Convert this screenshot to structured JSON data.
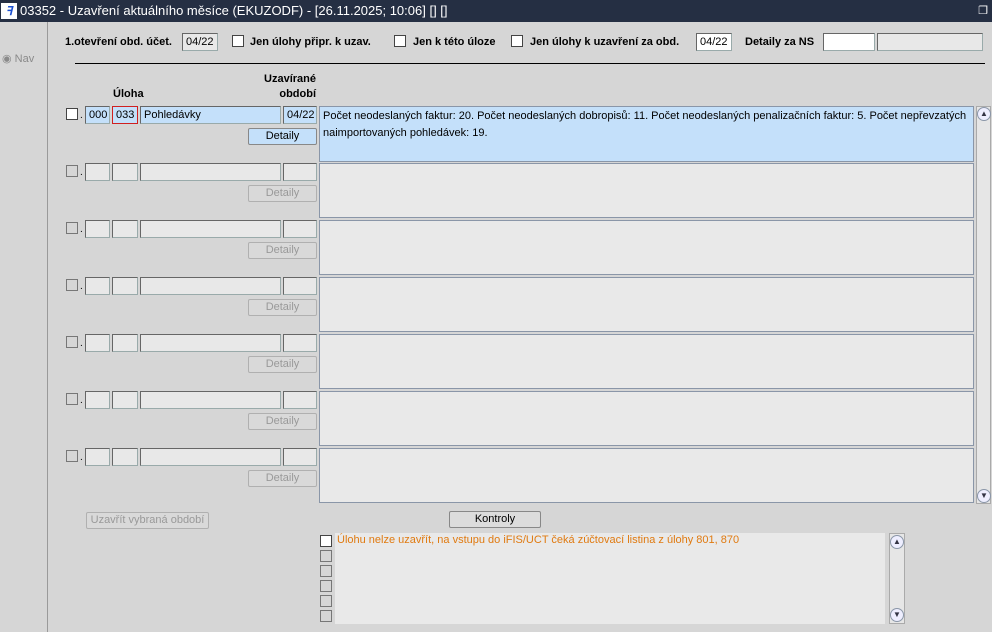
{
  "window": {
    "title": "03352 - Uzavření aktuálního měsíce (EKUZODF) - [26.11.2025; 10:06]  [] []",
    "logo": "iF"
  },
  "nav": {
    "label": "Nav"
  },
  "filters": {
    "first_open_label": "1.otevření obd. účet.",
    "first_open_value": "04/22",
    "only_prepared_label": "Jen úlohy připr. k uzav.",
    "only_this_task_label": "Jen k této úloze",
    "only_closing_label": "Jen úlohy k uzavření za obd.",
    "only_closing_value": "04/22",
    "details_ns_label": "Detaily za NS",
    "details_ns_value": "",
    "details_ns_name": ""
  },
  "columns": {
    "task": "Úloha",
    "period_line1": "Uzavírané",
    "period_line2": "období"
  },
  "rows": [
    {
      "code1": "000",
      "code2": "033",
      "name": "Pohledávky",
      "period": "04/22",
      "detail_button": "Detaily",
      "description": "Počet neodeslaných faktur: 20. Počet neodeslaných dobropisů: 11. Počet neodeslaných penalizačních faktur: 5. Počet nepřevzatých naimportovaných pohledávek: 19."
    },
    {
      "code1": "",
      "code2": "",
      "name": "",
      "period": "",
      "detail_button": "Detaily",
      "description": ""
    },
    {
      "code1": "",
      "code2": "",
      "name": "",
      "period": "",
      "detail_button": "Detaily",
      "description": ""
    },
    {
      "code1": "",
      "code2": "",
      "name": "",
      "period": "",
      "detail_button": "Detaily",
      "description": ""
    },
    {
      "code1": "",
      "code2": "",
      "name": "",
      "period": "",
      "detail_button": "Detaily",
      "description": ""
    },
    {
      "code1": "",
      "code2": "",
      "name": "",
      "period": "",
      "detail_button": "Detaily",
      "description": ""
    },
    {
      "code1": "",
      "code2": "",
      "name": "",
      "period": "",
      "detail_button": "Detaily",
      "description": ""
    }
  ],
  "buttons": {
    "close_selected": "Uzavřít vybraná období",
    "checks": "Kontroly"
  },
  "messages": [
    "Úlohu nelze uzavřít, na vstupu do iFIS/UCT čeká zúčtovací listina z úlohy 801, 870",
    "",
    "",
    "",
    "",
    ""
  ],
  "colors": {
    "message": "#e07a10",
    "selected": "#c4e0fa"
  }
}
